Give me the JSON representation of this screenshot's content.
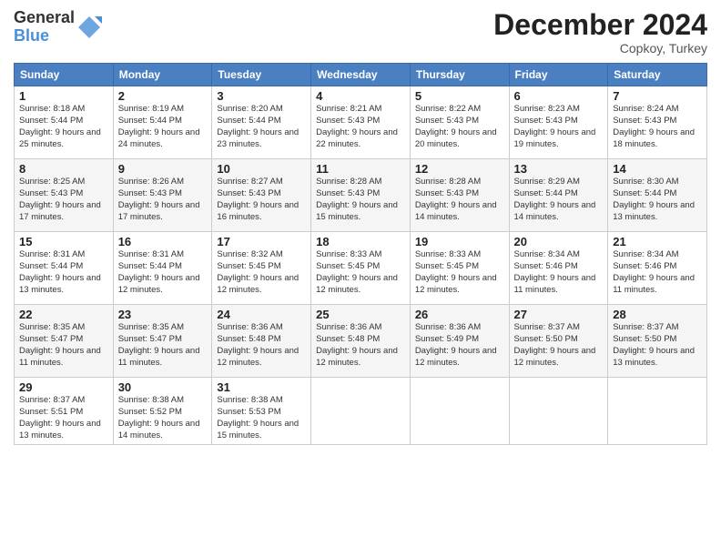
{
  "logo": {
    "general": "General",
    "blue": "Blue"
  },
  "header": {
    "title": "December 2024",
    "location": "Copkoy, Turkey"
  },
  "weekdays": [
    "Sunday",
    "Monday",
    "Tuesday",
    "Wednesday",
    "Thursday",
    "Friday",
    "Saturday"
  ],
  "weeks": [
    [
      {
        "day": "1",
        "sunrise": "8:18 AM",
        "sunset": "5:44 PM",
        "daylight": "9 hours and 25 minutes."
      },
      {
        "day": "2",
        "sunrise": "8:19 AM",
        "sunset": "5:44 PM",
        "daylight": "9 hours and 24 minutes."
      },
      {
        "day": "3",
        "sunrise": "8:20 AM",
        "sunset": "5:44 PM",
        "daylight": "9 hours and 23 minutes."
      },
      {
        "day": "4",
        "sunrise": "8:21 AM",
        "sunset": "5:43 PM",
        "daylight": "9 hours and 22 minutes."
      },
      {
        "day": "5",
        "sunrise": "8:22 AM",
        "sunset": "5:43 PM",
        "daylight": "9 hours and 20 minutes."
      },
      {
        "day": "6",
        "sunrise": "8:23 AM",
        "sunset": "5:43 PM",
        "daylight": "9 hours and 19 minutes."
      },
      {
        "day": "7",
        "sunrise": "8:24 AM",
        "sunset": "5:43 PM",
        "daylight": "9 hours and 18 minutes."
      }
    ],
    [
      {
        "day": "8",
        "sunrise": "8:25 AM",
        "sunset": "5:43 PM",
        "daylight": "9 hours and 17 minutes."
      },
      {
        "day": "9",
        "sunrise": "8:26 AM",
        "sunset": "5:43 PM",
        "daylight": "9 hours and 17 minutes."
      },
      {
        "day": "10",
        "sunrise": "8:27 AM",
        "sunset": "5:43 PM",
        "daylight": "9 hours and 16 minutes."
      },
      {
        "day": "11",
        "sunrise": "8:28 AM",
        "sunset": "5:43 PM",
        "daylight": "9 hours and 15 minutes."
      },
      {
        "day": "12",
        "sunrise": "8:28 AM",
        "sunset": "5:43 PM",
        "daylight": "9 hours and 14 minutes."
      },
      {
        "day": "13",
        "sunrise": "8:29 AM",
        "sunset": "5:44 PM",
        "daylight": "9 hours and 14 minutes."
      },
      {
        "day": "14",
        "sunrise": "8:30 AM",
        "sunset": "5:44 PM",
        "daylight": "9 hours and 13 minutes."
      }
    ],
    [
      {
        "day": "15",
        "sunrise": "8:31 AM",
        "sunset": "5:44 PM",
        "daylight": "9 hours and 13 minutes."
      },
      {
        "day": "16",
        "sunrise": "8:31 AM",
        "sunset": "5:44 PM",
        "daylight": "9 hours and 12 minutes."
      },
      {
        "day": "17",
        "sunrise": "8:32 AM",
        "sunset": "5:45 PM",
        "daylight": "9 hours and 12 minutes."
      },
      {
        "day": "18",
        "sunrise": "8:33 AM",
        "sunset": "5:45 PM",
        "daylight": "9 hours and 12 minutes."
      },
      {
        "day": "19",
        "sunrise": "8:33 AM",
        "sunset": "5:45 PM",
        "daylight": "9 hours and 12 minutes."
      },
      {
        "day": "20",
        "sunrise": "8:34 AM",
        "sunset": "5:46 PM",
        "daylight": "9 hours and 11 minutes."
      },
      {
        "day": "21",
        "sunrise": "8:34 AM",
        "sunset": "5:46 PM",
        "daylight": "9 hours and 11 minutes."
      }
    ],
    [
      {
        "day": "22",
        "sunrise": "8:35 AM",
        "sunset": "5:47 PM",
        "daylight": "9 hours and 11 minutes."
      },
      {
        "day": "23",
        "sunrise": "8:35 AM",
        "sunset": "5:47 PM",
        "daylight": "9 hours and 11 minutes."
      },
      {
        "day": "24",
        "sunrise": "8:36 AM",
        "sunset": "5:48 PM",
        "daylight": "9 hours and 12 minutes."
      },
      {
        "day": "25",
        "sunrise": "8:36 AM",
        "sunset": "5:48 PM",
        "daylight": "9 hours and 12 minutes."
      },
      {
        "day": "26",
        "sunrise": "8:36 AM",
        "sunset": "5:49 PM",
        "daylight": "9 hours and 12 minutes."
      },
      {
        "day": "27",
        "sunrise": "8:37 AM",
        "sunset": "5:50 PM",
        "daylight": "9 hours and 12 minutes."
      },
      {
        "day": "28",
        "sunrise": "8:37 AM",
        "sunset": "5:50 PM",
        "daylight": "9 hours and 13 minutes."
      }
    ],
    [
      {
        "day": "29",
        "sunrise": "8:37 AM",
        "sunset": "5:51 PM",
        "daylight": "9 hours and 13 minutes."
      },
      {
        "day": "30",
        "sunrise": "8:38 AM",
        "sunset": "5:52 PM",
        "daylight": "9 hours and 14 minutes."
      },
      {
        "day": "31",
        "sunrise": "8:38 AM",
        "sunset": "5:53 PM",
        "daylight": "9 hours and 15 minutes."
      },
      null,
      null,
      null,
      null
    ]
  ],
  "labels": {
    "sunrise": "Sunrise:",
    "sunset": "Sunset:",
    "daylight": "Daylight:"
  }
}
